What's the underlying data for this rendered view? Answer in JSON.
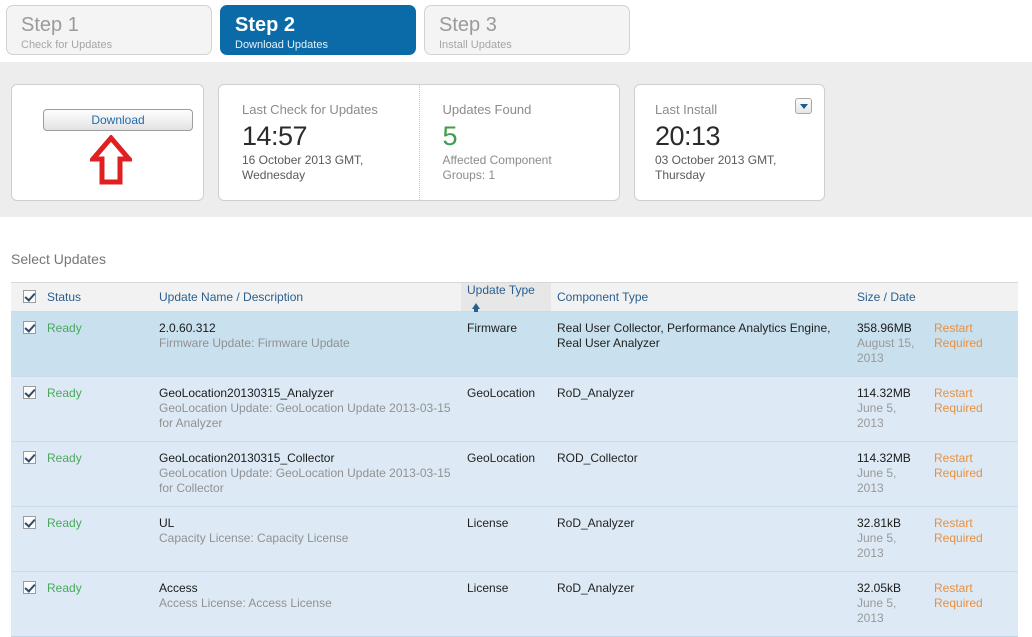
{
  "steps": [
    {
      "title": "Step 1",
      "subtitle": "Check for Updates",
      "active": false
    },
    {
      "title": "Step 2",
      "subtitle": "Download Updates",
      "active": true
    },
    {
      "title": "Step 3",
      "subtitle": "Install Updates",
      "active": false
    }
  ],
  "summary": {
    "download_button": "Download",
    "last_check": {
      "label": "Last Check for Updates",
      "time": "14:57",
      "date_line1": "16 October 2013 GMT,",
      "date_line2": "Wednesday"
    },
    "updates_found": {
      "label": "Updates Found",
      "count": "5",
      "affected_line1": "Affected Component",
      "affected_line2": "Groups: 1"
    },
    "last_install": {
      "label": "Last Install",
      "time": "20:13",
      "date_line1": "03 October 2013 GMT,",
      "date_line2": "Thursday",
      "dropdown_icon": "caret-down-icon"
    }
  },
  "table": {
    "section_title": "Select Updates",
    "sort_column": "Update Type",
    "sort_direction": "asc",
    "headers": {
      "status": "Status",
      "name": "Update Name / Description",
      "update_type": "Update Type",
      "component_type": "Component Type",
      "size_date": "Size / Date",
      "action": ""
    },
    "rows": [
      {
        "checked": true,
        "status": "Ready",
        "name": "2.0.60.312",
        "description": "Firmware Update: Firmware Update",
        "update_type": "Firmware",
        "component_type": "Real User Collector, Performance Analytics Engine, Real User Analyzer",
        "size": "358.96MB",
        "date": "August 15, 2013",
        "action": "Restart Required",
        "selected": true
      },
      {
        "checked": true,
        "status": "Ready",
        "name": "GeoLocation20130315_Analyzer",
        "description": "GeoLocation Update: GeoLocation Update 2013-03-15 for Analyzer",
        "update_type": "GeoLocation",
        "component_type": "RoD_Analyzer",
        "size": "114.32MB",
        "date": "June 5, 2013",
        "action": "Restart Required",
        "selected": false
      },
      {
        "checked": true,
        "status": "Ready",
        "name": "GeoLocation20130315_Collector",
        "description": "GeoLocation Update: GeoLocation Update 2013-03-15 for Collector",
        "update_type": "GeoLocation",
        "component_type": "ROD_Collector",
        "size": "114.32MB",
        "date": "June 5, 2013",
        "action": "Restart Required",
        "selected": false
      },
      {
        "checked": true,
        "status": "Ready",
        "name": "UL",
        "description": "Capacity License: Capacity License",
        "update_type": "License",
        "component_type": "RoD_Analyzer",
        "size": "32.81kB",
        "date": "June 5, 2013",
        "action": "Restart Required",
        "selected": false
      },
      {
        "checked": true,
        "status": "Ready",
        "name": "Access",
        "description": "Access License: Access License",
        "update_type": "License",
        "component_type": "RoD_Analyzer",
        "size": "32.05kB",
        "date": "June 5, 2013",
        "action": "Restart Required",
        "selected": false
      }
    ],
    "select_all_checked": true
  },
  "annotation": {
    "arrow_icon": "red-arrow-up-icon",
    "arrow_color": "#e02020"
  },
  "colors": {
    "active_step": "#0a6ba8",
    "ready": "#4aa85c",
    "restart": "#e89040",
    "count": "#3f9e4d",
    "row_selected": "#c9e0ef",
    "row_normal": "#ddeaf5"
  }
}
